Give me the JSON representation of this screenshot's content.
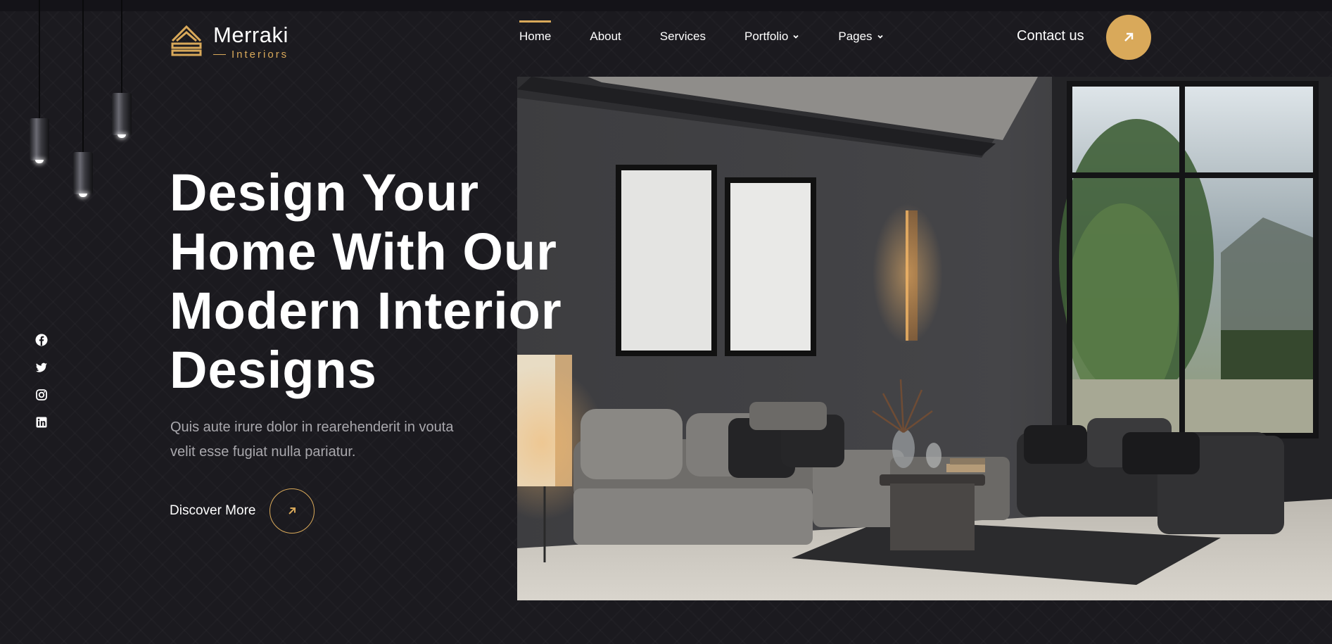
{
  "brand": {
    "name": "Merraki",
    "tagline": "Interiors",
    "logo_icon": "stacked-roof-logo-icon"
  },
  "nav": {
    "items": [
      {
        "label": "Home",
        "active": true,
        "dropdown": false
      },
      {
        "label": "About",
        "active": false,
        "dropdown": false
      },
      {
        "label": "Services",
        "active": false,
        "dropdown": false
      },
      {
        "label": "Portfolio",
        "active": false,
        "dropdown": true
      },
      {
        "label": "Pages",
        "active": false,
        "dropdown": true
      }
    ]
  },
  "contact": {
    "label": "Contact us",
    "icon": "arrow-up-right-icon"
  },
  "hero": {
    "title_lines": [
      "Design Your",
      "Home With Our",
      "Modern Interior",
      "Designs"
    ],
    "description_lines": [
      "Quis aute irure dolor in rearehenderit in vouta",
      "velit esse fugiat nulla pariatur."
    ],
    "cta_label": "Discover More",
    "cta_icon": "arrow-up-right-icon",
    "image_icon": "living-room-photo"
  },
  "socials": [
    {
      "name": "facebook",
      "icon": "facebook-icon"
    },
    {
      "name": "twitter",
      "icon": "twitter-icon"
    },
    {
      "name": "instagram",
      "icon": "instagram-icon"
    },
    {
      "name": "linkedin",
      "icon": "linkedin-icon"
    }
  ],
  "colors": {
    "background": "#1b1a1f",
    "accent": "#d9a95a",
    "text": "#ffffff",
    "muted_text": "#a9a8ad"
  }
}
